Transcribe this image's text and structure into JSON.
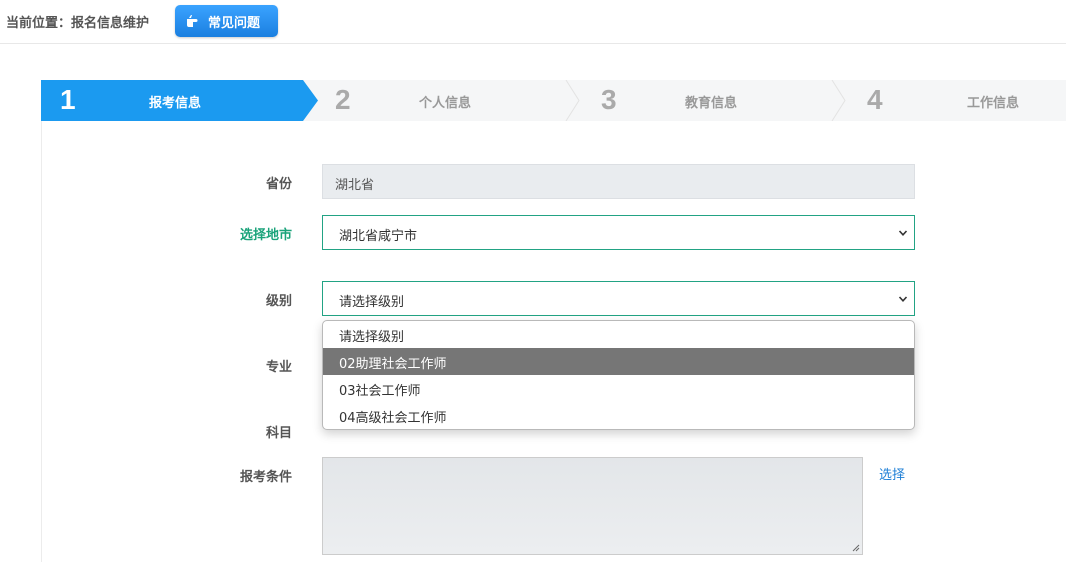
{
  "header": {
    "breadcrumb": "当前位置：报名信息维护",
    "faq_button": "常见问题",
    "faq_icon": "pointing-hand-icon"
  },
  "steps": [
    {
      "number": "1",
      "label": "报考信息",
      "active": true
    },
    {
      "number": "2",
      "label": "个人信息",
      "active": false
    },
    {
      "number": "3",
      "label": "教育信息",
      "active": false
    },
    {
      "number": "4",
      "label": "工作信息",
      "active": false
    }
  ],
  "form": {
    "province_label": "省份",
    "province_value": "湖北省",
    "city_label": "选择地市",
    "city_value": "湖北省咸宁市",
    "level_label": "级别",
    "level_value": "请选择级别",
    "level_options": [
      "请选择级别",
      "02助理社会工作师",
      "03社会工作师",
      "04高级社会工作师"
    ],
    "level_highlighted": "02助理社会工作师",
    "major_label": "专业",
    "subject_label": "科目",
    "condition_label": "报考条件",
    "condition_value": "",
    "choose_link": "选择"
  },
  "colors": {
    "active_step": "#1b9af0",
    "accent_green": "#1aa37a",
    "link_blue": "#1e7fd6"
  }
}
